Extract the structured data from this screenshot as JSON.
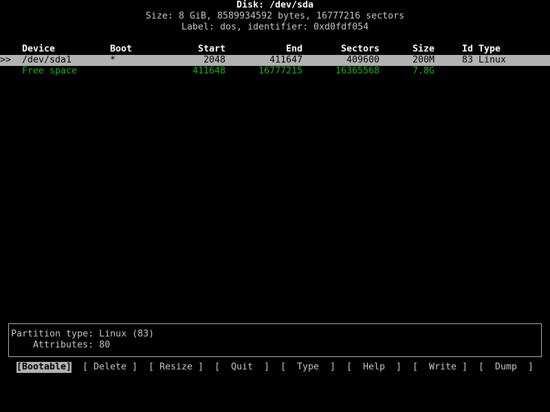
{
  "header": {
    "title": "Disk: /dev/sda",
    "size_line": "Size: 8 GiB, 8589934592 bytes, 16777216 sectors",
    "label_line": "Label: dos, identifier: 0xd0fdf054"
  },
  "table": {
    "columns": {
      "device": "Device",
      "boot": "Boot",
      "start": "Start",
      "end": "End",
      "sectors": "Sectors",
      "size": "Size",
      "id_type": "Id Type"
    },
    "rows": [
      {
        "cursor": ">>",
        "device": "/dev/sda1",
        "boot": "*",
        "start": "2048",
        "end": "411647",
        "sectors": "409600",
        "size": "200M",
        "id_type": "83 Linux"
      },
      {
        "cursor": "",
        "device": "Free space",
        "boot": "",
        "start": "411648",
        "end": "16777215",
        "sectors": "16365568",
        "size": "7.8G",
        "id_type": ""
      }
    ]
  },
  "info": {
    "partition_type": "Partition type: Linux (83)",
    "attributes": "    Attributes: 80"
  },
  "menu": {
    "bootable": "[Bootable]",
    "delete": "[ Delete ]",
    "resize": "[ Resize ]",
    "quit": "[  Quit  ]",
    "type": "[  Type  ]",
    "help": "[  Help  ]",
    "write": "[  Write ]",
    "dump": "[  Dump  ]"
  },
  "colors": {
    "background": "#000000",
    "text": "#c8c8c8",
    "selection": "#b2b2b2",
    "free_space": "#18b218"
  }
}
